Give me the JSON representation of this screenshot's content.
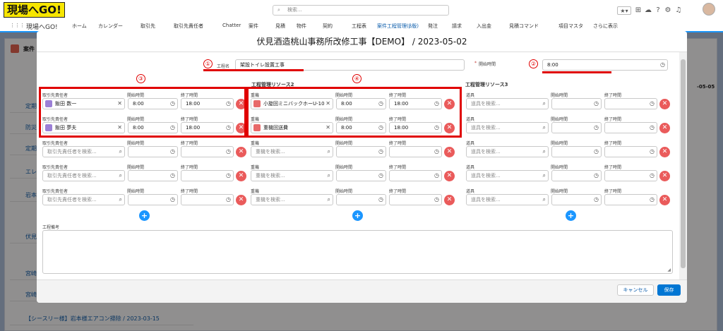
{
  "app": {
    "logo": "現場へGO!",
    "search_placeholder": "検索...",
    "user_icon": "avatar"
  },
  "nav": {
    "app_name": "現場へGO!",
    "items": [
      "ホーム",
      "カレンダー",
      "取引先",
      "取引先責任者",
      "Chatter",
      "案件",
      "見積",
      "物件",
      "契約",
      "工程表",
      "案件工程管理(β版)",
      "発注",
      "請求",
      "入出金",
      "見積コマンド",
      "項目マスタ",
      "さらに表示"
    ]
  },
  "background": {
    "list_label": "案件",
    "rows": [
      "定期",
      "防災",
      "定期",
      "エレベ",
      "岩本",
      "伏見",
      "宮崎",
      "宮崎"
    ],
    "last_row": "【シースリー様】岩本様エアコン掃除 / 2023-03-15",
    "side_label": "-05-05"
  },
  "modal": {
    "title": "伏見酒造桃山事務所改修工事【DEMO】 / 2023-05-02",
    "process_name_label": "工程名",
    "process_name_value": "架設トイレ設置工事",
    "start_time_label": "開始時間",
    "start_time_value": "8:00",
    "sections": [
      {
        "title": "",
        "resource_label": "取引先責任者",
        "placeholder": "取引先責任者を検索...",
        "rows": [
          {
            "value": "飯田 数一",
            "start": "8:00",
            "end": "18:00"
          },
          {
            "value": "飯田 夢夫",
            "start": "8:00",
            "end": "18:00"
          },
          {
            "value": "",
            "start": "",
            "end": ""
          },
          {
            "value": "",
            "start": "",
            "end": ""
          },
          {
            "value": "",
            "start": "",
            "end": ""
          }
        ]
      },
      {
        "title": "工程管理リソース2",
        "resource_label": "重機",
        "placeholder": "重機を検索...",
        "rows": [
          {
            "value": "小旋回ミニバックホーU-10",
            "start": "8:00",
            "end": "18:00"
          },
          {
            "value": "重機回送費",
            "start": "8:00",
            "end": "18:00"
          },
          {
            "value": "",
            "start": "",
            "end": ""
          },
          {
            "value": "",
            "start": "",
            "end": ""
          },
          {
            "value": "",
            "start": "",
            "end": ""
          }
        ]
      },
      {
        "title": "工程管理リソース3",
        "resource_label": "道具",
        "placeholder": "道具を検索...",
        "rows": [
          {
            "value": "",
            "start": "",
            "end": ""
          },
          {
            "value": "",
            "start": "",
            "end": ""
          },
          {
            "value": "",
            "start": "",
            "end": ""
          },
          {
            "value": "",
            "start": "",
            "end": ""
          },
          {
            "value": "",
            "start": "",
            "end": ""
          }
        ]
      }
    ],
    "start_label": "開始時間",
    "end_label": "終了時間",
    "remarks_label": "工程備考",
    "cancel_label": "キャンセル",
    "save_label": "保存",
    "required_mark": "*"
  },
  "annotations": [
    "①",
    "②",
    "③",
    "④"
  ],
  "colors": {
    "accent": "#0176d3",
    "delete": "#ea5b5b",
    "annotation": "#e00000",
    "contact_pill": "#9b7fd6",
    "machine_pill": "#e86a6a"
  }
}
